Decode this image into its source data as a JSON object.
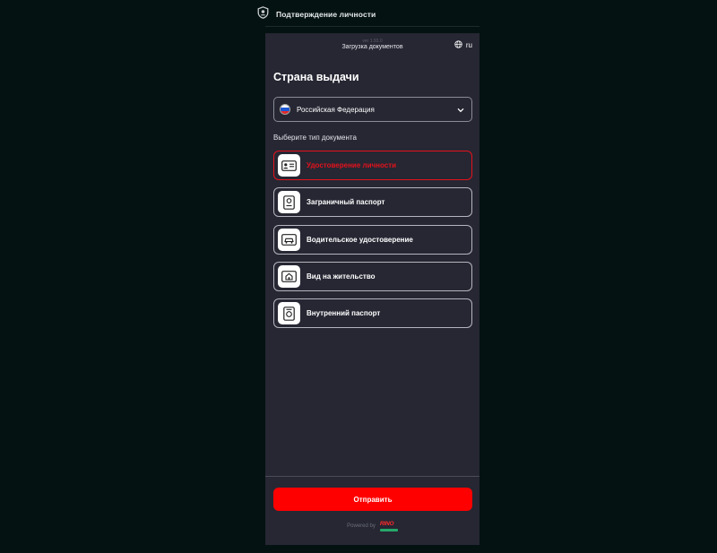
{
  "header": {
    "title": "Подтверждение личности"
  },
  "panel": {
    "version": "ver 1.93.0",
    "section_title": "Загрузка документов",
    "language": "ru"
  },
  "country": {
    "heading": "Страна выдачи",
    "selected": "Российская Федерация",
    "flag_colors": [
      "#ffffff",
      "#1c57d6",
      "#e42a2a"
    ]
  },
  "documents": {
    "label": "Выберите тип документа",
    "items": [
      {
        "label": "Удостоверение личности",
        "icon": "id-card-icon",
        "selected": true
      },
      {
        "label": "Заграничный паспорт",
        "icon": "passport-icon",
        "selected": false
      },
      {
        "label": "Водительское удостоверение",
        "icon": "driver-license-icon",
        "selected": false
      },
      {
        "label": "Вид на жительство",
        "icon": "residence-permit-icon",
        "selected": false
      },
      {
        "label": "Внутренний паспорт",
        "icon": "internal-passport-icon",
        "selected": false
      }
    ]
  },
  "footer": {
    "submit_label": "Отправить",
    "powered_by": "Powered by",
    "logo_text": "RINO"
  },
  "colors": {
    "accent": "#ff0000",
    "selected_border": "#e4121c",
    "background": "#041212",
    "panel": "#262733"
  }
}
